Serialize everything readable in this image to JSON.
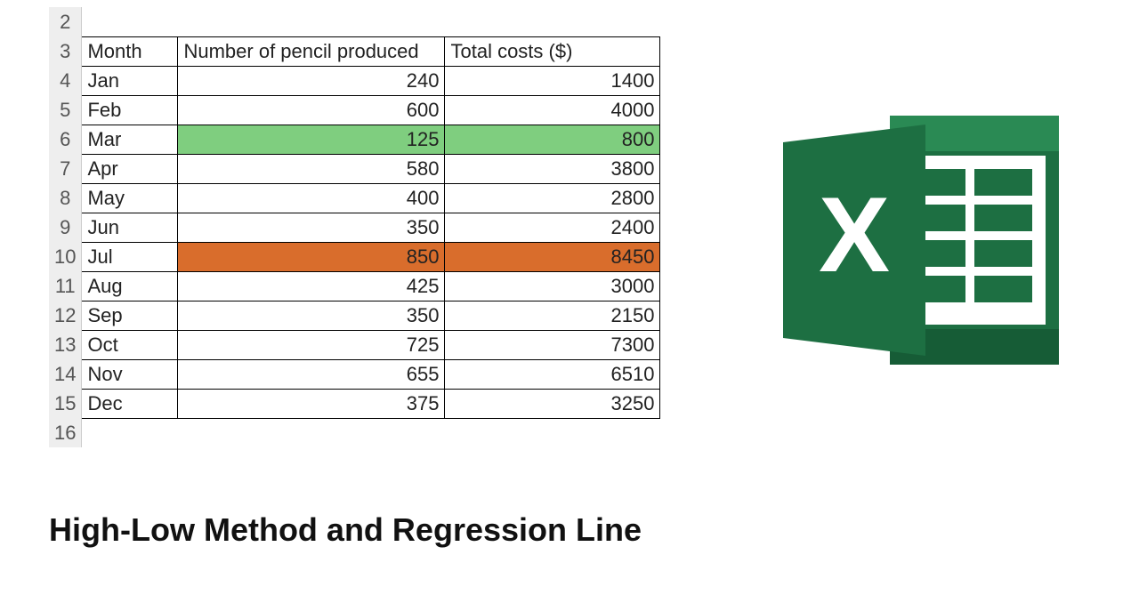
{
  "title": "High-Low Method and Regression Line",
  "row_numbers": [
    "2",
    "3",
    "4",
    "5",
    "6",
    "7",
    "8",
    "9",
    "10",
    "11",
    "12",
    "13",
    "14",
    "15",
    "16"
  ],
  "headers": {
    "month": "Month",
    "pencil": "Number of pencil produced",
    "cost": "Total costs ($)"
  },
  "rows": [
    {
      "month": "Jan",
      "pencil": "240",
      "cost": "1400",
      "hl": ""
    },
    {
      "month": "Feb",
      "pencil": "600",
      "cost": "4000",
      "hl": ""
    },
    {
      "month": "Mar",
      "pencil": "125",
      "cost": "800",
      "hl": "green"
    },
    {
      "month": "Apr",
      "pencil": "580",
      "cost": "3800",
      "hl": ""
    },
    {
      "month": "May",
      "pencil": "400",
      "cost": "2800",
      "hl": ""
    },
    {
      "month": "Jun",
      "pencil": "350",
      "cost": "2400",
      "hl": ""
    },
    {
      "month": "Jul",
      "pencil": "850",
      "cost": "8450",
      "hl": "orange"
    },
    {
      "month": "Aug",
      "pencil": "425",
      "cost": "3000",
      "hl": ""
    },
    {
      "month": "Sep",
      "pencil": "350",
      "cost": "2150",
      "hl": ""
    },
    {
      "month": "Oct",
      "pencil": "725",
      "cost": "7300",
      "hl": ""
    },
    {
      "month": "Nov",
      "pencil": "655",
      "cost": "6510",
      "hl": ""
    },
    {
      "month": "Dec",
      "pencil": "375",
      "cost": "3250",
      "hl": ""
    }
  ],
  "logo": {
    "name": "excel-icon",
    "color_dark": "#1d6f42",
    "color_mid": "#2a8a54",
    "color_light": "#3aa065"
  }
}
